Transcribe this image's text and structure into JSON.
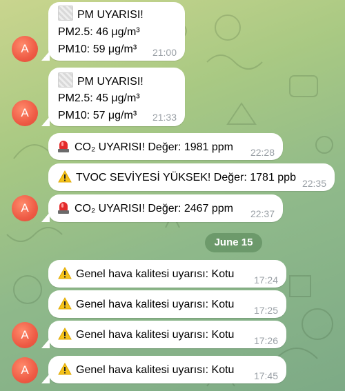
{
  "avatar_letter": "A",
  "date_separator": "June 15",
  "colors": {
    "bubble": "#ffffff",
    "avatar": "#ee5b45",
    "time": "#9aa0a6",
    "date_pill": "#5a8a5a"
  },
  "messages": [
    {
      "lines": [
        "PM UYARISI!",
        "PM2.5: 46 μg/m³",
        "PM10: 59 μg/m³"
      ],
      "time": "21:00",
      "icon": "image-icon"
    },
    {
      "lines": [
        "PM UYARISI!",
        "PM2.5: 45 μg/m³",
        "PM10: 57 μg/m³"
      ],
      "time": "21:33",
      "icon": "image-icon"
    },
    {
      "text": "CO₂ UYARISI! Değer: 1981 ppm",
      "time": "22:28",
      "icon": "siren-icon"
    },
    {
      "text": "TVOC SEVİYESİ YÜKSEK! Değer: 1781 ppb",
      "time": "22:35",
      "icon": "warning-icon"
    },
    {
      "text": "CO₂ UYARISI! Değer: 2467 ppm",
      "time": "22:37",
      "icon": "siren-icon"
    },
    {
      "text": "Genel hava kalitesi uyarısı: Kotu",
      "time": "17:24",
      "icon": "warning-icon"
    },
    {
      "text": "Genel hava kalitesi uyarısı: Kotu",
      "time": "17:25",
      "icon": "warning-icon"
    },
    {
      "text": "Genel hava kalitesi uyarısı: Kotu",
      "time": "17:26",
      "icon": "warning-icon"
    },
    {
      "text": "Genel hava kalitesi uyarısı: Kotu",
      "time": "17:45",
      "icon": "warning-icon"
    }
  ]
}
